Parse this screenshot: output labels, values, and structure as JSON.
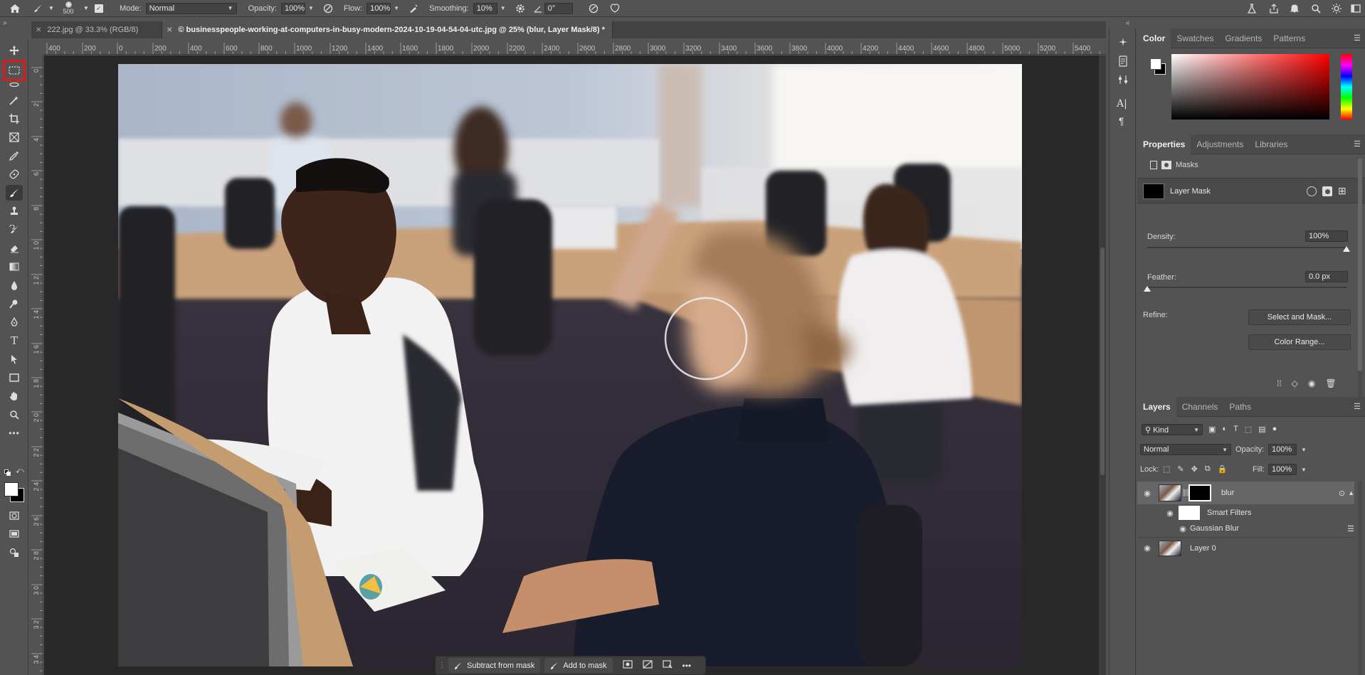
{
  "options_bar": {
    "brush_size": "500",
    "mode_label": "Mode:",
    "mode_value": "Normal",
    "opacity_label": "Opacity:",
    "opacity_value": "100%",
    "flow_label": "Flow:",
    "flow_value": "100%",
    "smoothing_label": "Smoothing:",
    "smoothing_value": "10%",
    "angle_value": "0°"
  },
  "tabs": [
    {
      "label": "222.jpg @ 33.3% (RGB/8)"
    },
    {
      "label": "© businesspeople-working-at-computers-in-busy-modern-2024-10-19-04-54-04-utc.jpg @ 25% (blur, Layer Mask/8) *"
    }
  ],
  "ruler_h": [
    "400",
    "200",
    "0",
    "200",
    "400",
    "600",
    "800",
    "1000",
    "1200",
    "1400",
    "1600",
    "1800",
    "2000",
    "2200",
    "2400",
    "2600",
    "2800",
    "3000",
    "3200",
    "3400",
    "3600",
    "3800",
    "4000",
    "4200",
    "4400",
    "4600",
    "4800",
    "5000",
    "5200",
    "5400"
  ],
  "ruler_v": [
    "0",
    "2",
    "4",
    "6",
    "8",
    "1 0",
    "1 2",
    "1 4",
    "1 6",
    "1 8",
    "2 0",
    "2 2",
    "2 4",
    "2 6",
    "2 8",
    "3 0",
    "3 2",
    "3 4"
  ],
  "color_panel": {
    "tabs": [
      "Color",
      "Swatches",
      "Gradients",
      "Patterns"
    ],
    "fg": "#ffffff",
    "bg": "#000000",
    "hue": "#ff0000"
  },
  "properties_panel": {
    "tabs": [
      "Properties",
      "Adjustments",
      "Libraries"
    ],
    "section": "Masks",
    "mask_name": "Layer Mask",
    "density_label": "Density:",
    "density_value": "100%",
    "density_level": 1.0,
    "feather_label": "Feather:",
    "feather_value": "0.0 px",
    "feather_level": 0.0,
    "refine_label": "Refine:",
    "select_mask_btn": "Select and Mask...",
    "color_range_btn": "Color Range..."
  },
  "layers_panel": {
    "tabs": [
      "Layers",
      "Channels",
      "Paths"
    ],
    "filter_kind": "Kind",
    "blend_mode": "Normal",
    "opacity_label": "Opacity:",
    "opacity_value": "100%",
    "lock_label": "Lock:",
    "fill_label": "Fill:",
    "fill_value": "100%",
    "layers": [
      {
        "name": "blur"
      },
      {
        "name": "Smart Filters"
      },
      {
        "name": "Gaussian Blur"
      },
      {
        "name": "Layer 0"
      }
    ]
  },
  "context_bar": {
    "subtract_label": "Subtract from mask",
    "add_label": "Add to mask"
  },
  "highlight_color": "#e0191e"
}
